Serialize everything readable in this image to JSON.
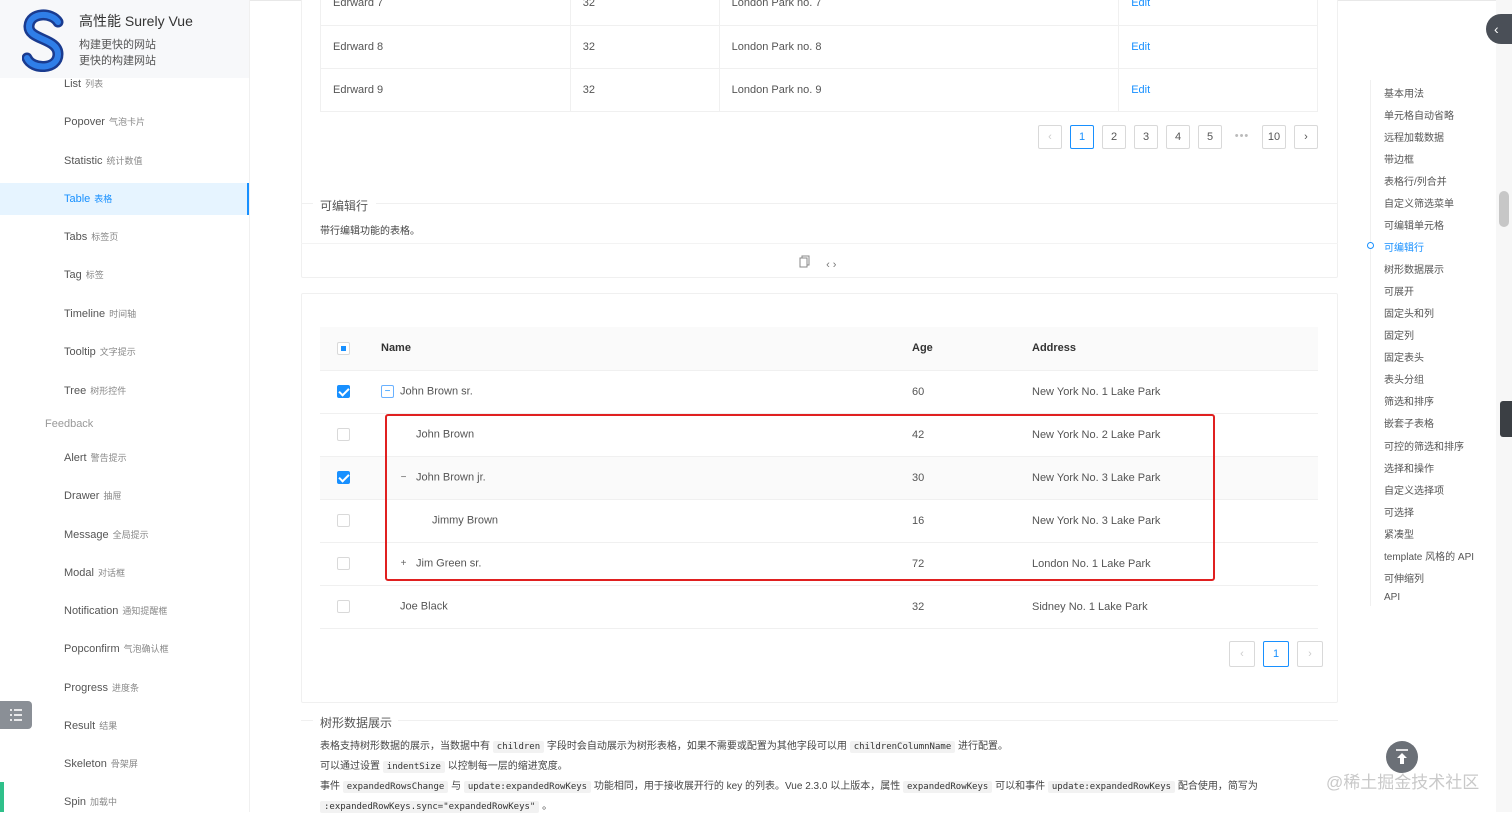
{
  "brand": {
    "title": "高性能 Surely Vue",
    "tagline1": "构建更快的网站",
    "tagline2": "更快的构建网站"
  },
  "sidebar": {
    "items": [
      {
        "en": "List",
        "zh": "列表"
      },
      {
        "en": "Popover",
        "zh": "气泡卡片"
      },
      {
        "en": "Statistic",
        "zh": "统计数值"
      },
      {
        "en": "Table",
        "zh": "表格"
      },
      {
        "en": "Tabs",
        "zh": "标签页"
      },
      {
        "en": "Tag",
        "zh": "标签"
      },
      {
        "en": "Timeline",
        "zh": "时间轴"
      },
      {
        "en": "Tooltip",
        "zh": "文字提示"
      },
      {
        "en": "Tree",
        "zh": "树形控件"
      }
    ],
    "group": "Feedback",
    "feedback_items": [
      {
        "en": "Alert",
        "zh": "警告提示"
      },
      {
        "en": "Drawer",
        "zh": "抽屉"
      },
      {
        "en": "Message",
        "zh": "全局提示"
      },
      {
        "en": "Modal",
        "zh": "对话框"
      },
      {
        "en": "Notification",
        "zh": "通知提醒框"
      },
      {
        "en": "Popconfirm",
        "zh": "气泡确认框"
      },
      {
        "en": "Progress",
        "zh": "进度条"
      },
      {
        "en": "Result",
        "zh": "结果"
      },
      {
        "en": "Skeleton",
        "zh": "骨架屏"
      },
      {
        "en": "Spin",
        "zh": "加载中"
      }
    ]
  },
  "top_table": {
    "rows": [
      {
        "name": "Edrward 7",
        "age": "32",
        "address": "London Park no. 7",
        "action": "Edit"
      },
      {
        "name": "Edrward 8",
        "age": "32",
        "address": "London Park no. 8",
        "action": "Edit"
      },
      {
        "name": "Edrward 9",
        "age": "32",
        "address": "London Park no. 9",
        "action": "Edit"
      }
    ],
    "pager": [
      "1",
      "2",
      "3",
      "4",
      "5",
      "•••",
      "10"
    ]
  },
  "editable_section": {
    "title": "可编辑行",
    "desc": "带行编辑功能的表格。"
  },
  "tree_table": {
    "headers": {
      "name": "Name",
      "age": "Age",
      "address": "Address"
    },
    "rows": [
      {
        "name": "John Brown sr.",
        "age": "60",
        "address": "New York No. 1 Lake Park"
      },
      {
        "name": "John Brown",
        "age": "42",
        "address": "New York No. 2 Lake Park"
      },
      {
        "name": "John Brown jr.",
        "age": "30",
        "address": "New York No. 3 Lake Park"
      },
      {
        "name": "Jimmy Brown",
        "age": "16",
        "address": "New York No. 3 Lake Park"
      },
      {
        "name": "Jim Green sr.",
        "age": "72",
        "address": "London No. 1 Lake Park"
      },
      {
        "name": "Joe Black",
        "age": "32",
        "address": "Sidney No. 1 Lake Park"
      }
    ],
    "pager_current": "1"
  },
  "tree_section": {
    "title": "树形数据展示",
    "line1_a": "表格支持树形数据的展示，当数据中有",
    "line1_code1": "children",
    "line1_b": "字段时会自动展示为树形表格，如果不需要或配置为其他字段可以用",
    "line1_code2": "childrenColumnName",
    "line1_c": "进行配置。",
    "line2_a": "可以通过设置",
    "line2_code": "indentSize",
    "line2_b": "以控制每一层的缩进宽度。",
    "line3_a": "事件",
    "line3_code1": "expandedRowsChange",
    "line3_b": "与",
    "line3_code2": "update:expandedRowKeys",
    "line3_c": "功能相同，用于接收展开行的 key 的列表。Vue 2.3.0 以上版本，属性",
    "line3_code3": "expandedRowKeys",
    "line3_d": "可以和事件",
    "line3_code4": "update:expandedRowKeys",
    "line3_e": "配合使用，简写为",
    "line4_code": ":expandedRowKeys.sync=\"expandedRowKeys\"",
    "line4_b": "。"
  },
  "toc": [
    "基本用法",
    "单元格自动省略",
    "远程加载数据",
    "带边框",
    "表格行/列合并",
    "自定义筛选菜单",
    "可编辑单元格",
    "可编辑行",
    "树形数据展示",
    "可展开",
    "固定头和列",
    "固定列",
    "固定表头",
    "表头分组",
    "筛选和排序",
    "嵌套子表格",
    "可控的筛选和排序",
    "选择和操作",
    "自定义选择项",
    "可选择",
    "紧凑型",
    "template 风格的 API",
    "可伸缩列",
    "API"
  ],
  "watermark": "@稀土掘金技术社区",
  "colors": {
    "accent": "#1890ff",
    "highlight": "#e02020"
  }
}
